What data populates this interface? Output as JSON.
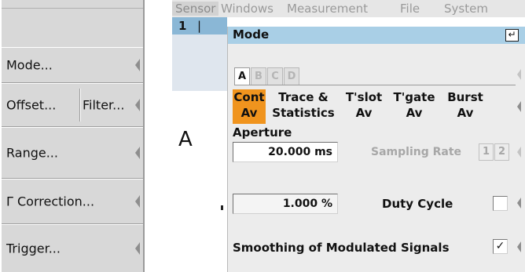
{
  "softkeys": {
    "mode": "Mode...",
    "offset": "Offset...",
    "filter": "Filter...",
    "range": "Range...",
    "correction": "Γ Correction...",
    "trigger": "Trigger..."
  },
  "menu": [
    "Sensor",
    "Windows",
    "Measurement",
    "File",
    "System"
  ],
  "channel": {
    "number": "1",
    "separator": "|"
  },
  "window_letter": "A",
  "dialog": {
    "title": "Mode",
    "enter_symbol": "↵",
    "tabs": [
      "A",
      "B",
      "C",
      "D"
    ],
    "selected_tab": "A",
    "modes": [
      {
        "line1": "Cont",
        "line2": "Av"
      },
      {
        "line1": "Trace &",
        "line2": "Statistics"
      },
      {
        "line1": "T'slot",
        "line2": "Av"
      },
      {
        "line1": "T'gate",
        "line2": "Av"
      },
      {
        "line1": "Burst",
        "line2": "Av"
      }
    ],
    "selected_mode": "Cont Av",
    "aperture_label": "Aperture",
    "aperture_value": "20.000 ms",
    "sampling_rate_label": "Sampling Rate",
    "sampling_rate_options": [
      "1",
      "2"
    ],
    "duty_cycle_value": "1.000 %",
    "duty_cycle_label": "Duty Cycle",
    "duty_cycle_checked": "",
    "smoothing_label": "Smoothing of Modulated Signals",
    "smoothing_checked": "✓"
  },
  "colors": {
    "selected_mode": "#f0941e",
    "dialog_title_bar": "#a9cfe6",
    "channel_bar": "#8ab7d6"
  }
}
